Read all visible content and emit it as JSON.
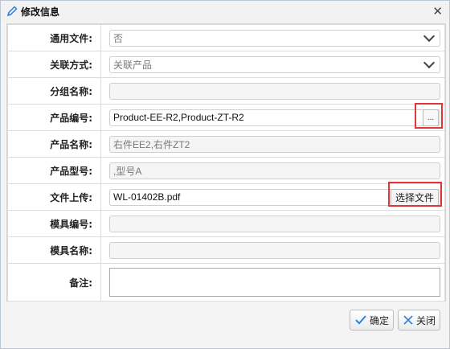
{
  "dialog": {
    "title": "修改信息",
    "close_glyph": "✕"
  },
  "form": {
    "general_file": {
      "label": "通用文件:",
      "value": "否"
    },
    "link_mode": {
      "label": "关联方式:",
      "value": "关联产品"
    },
    "group_name": {
      "label": "分组名称:",
      "value": ""
    },
    "product_code": {
      "label": "产品编号:",
      "value": "Product-EE-R2,Product-ZT-R2",
      "picker_label": "..."
    },
    "product_name": {
      "label": "产品名称:",
      "value": "右件EE2,右件ZT2"
    },
    "product_model": {
      "label": "产品型号:",
      "value": ",型号A"
    },
    "file_upload": {
      "label": "文件上传:",
      "value": "WL-01402B.pdf",
      "button_label": "选择文件"
    },
    "mold_code": {
      "label": "模具编号:",
      "value": ""
    },
    "mold_name": {
      "label": "模具名称:",
      "value": ""
    },
    "remark": {
      "label": "备注:",
      "value": ""
    }
  },
  "footer": {
    "confirm_label": "确定",
    "close_label": "关闭"
  },
  "colors": {
    "highlight": "#e23535",
    "accent_icon": "#2f7fd8"
  }
}
